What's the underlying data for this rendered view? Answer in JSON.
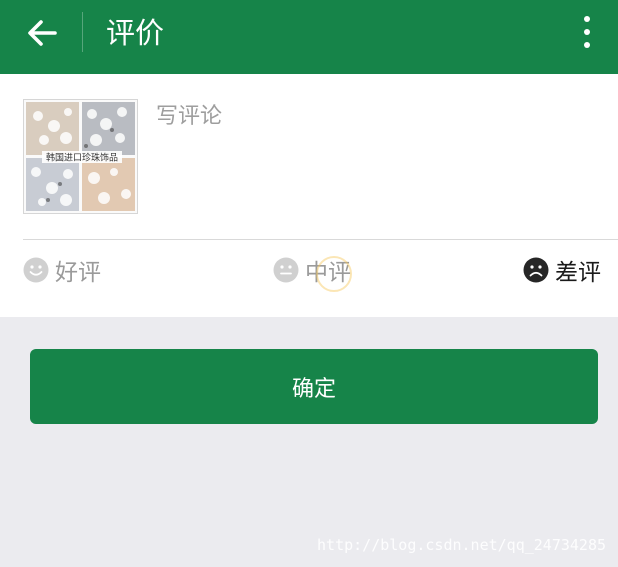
{
  "appbar": {
    "title": "评价",
    "background": "#168449",
    "back_icon": "arrow-left-icon",
    "menu_icon": "more-vertical-icon"
  },
  "review": {
    "product_image_caption": "韩国进口珍珠饰品",
    "comment_placeholder": "写评论",
    "ratings": [
      {
        "label": "好评",
        "icon": "smile-face-icon",
        "selected": false
      },
      {
        "label": "中评",
        "icon": "neutral-face-icon",
        "selected": false
      },
      {
        "label": "差评",
        "icon": "sad-face-icon",
        "selected": true
      }
    ]
  },
  "actions": {
    "confirm_label": "确定"
  },
  "watermark": "http://blog.csdn.net/qq_24734285"
}
